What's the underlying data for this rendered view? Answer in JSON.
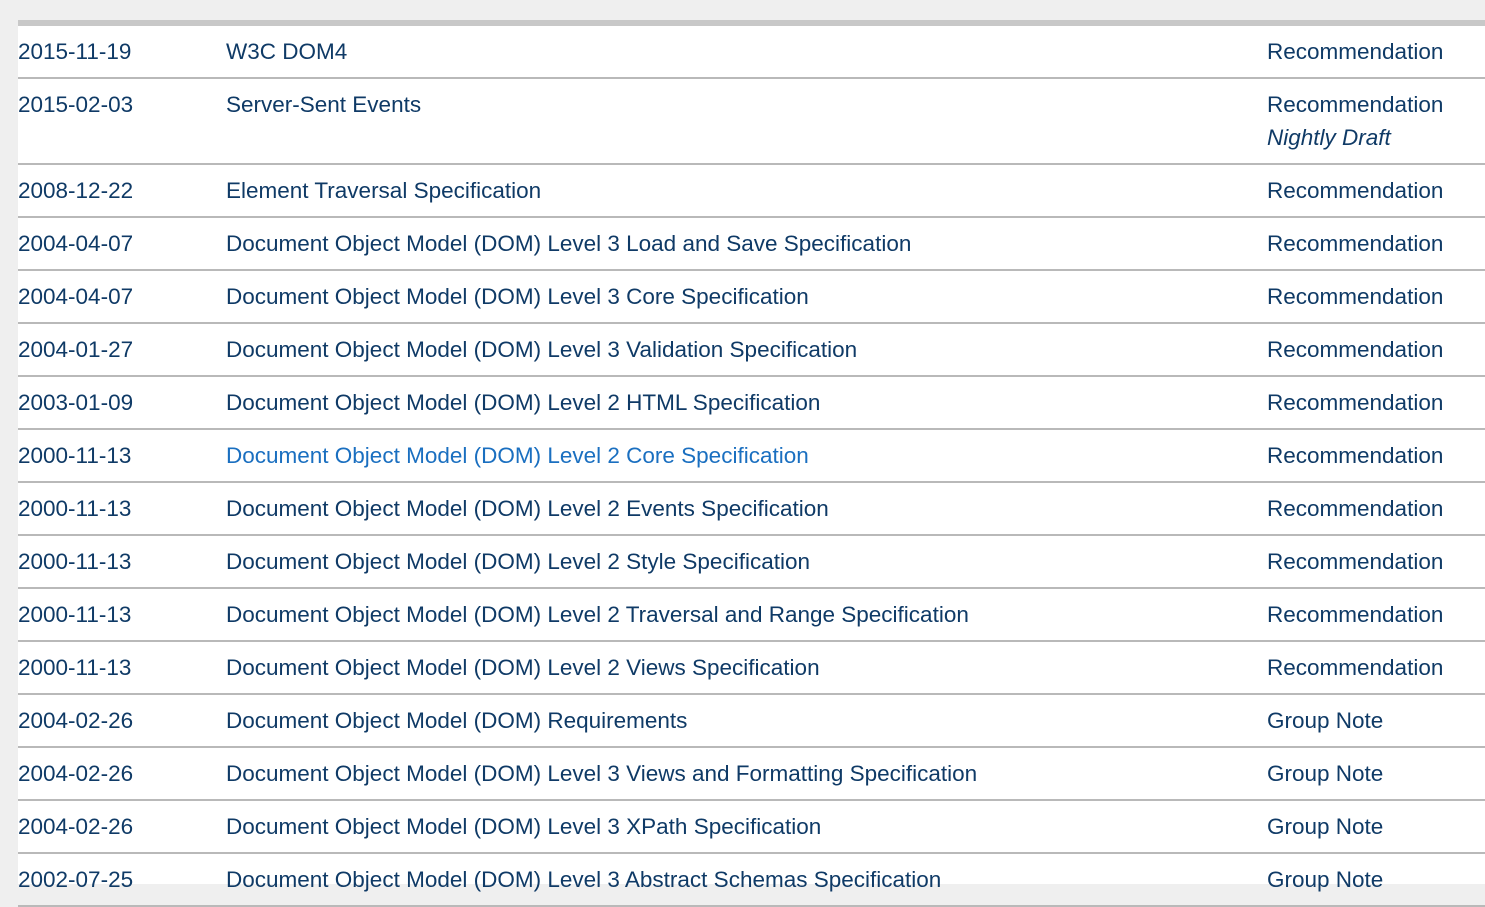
{
  "colors": {
    "text": "#0f3a66",
    "link_hover": "#1a6fc0",
    "row_border": "#b9b9b9",
    "page_bg": "#efefef"
  },
  "rows": [
    {
      "date": "2015-11-19",
      "title": "W3C DOM4",
      "status": "Recommendation",
      "note": ""
    },
    {
      "date": "2015-02-03",
      "title": "Server-Sent Events",
      "status": "Recommendation",
      "note": "Nightly Draft"
    },
    {
      "date": "2008-12-22",
      "title": "Element Traversal Specification",
      "status": "Recommendation",
      "note": ""
    },
    {
      "date": "2004-04-07",
      "title": "Document Object Model (DOM) Level 3 Load and Save Specification",
      "status": "Recommendation",
      "note": ""
    },
    {
      "date": "2004-04-07",
      "title": "Document Object Model (DOM) Level 3 Core Specification",
      "status": "Recommendation",
      "note": ""
    },
    {
      "date": "2004-01-27",
      "title": "Document Object Model (DOM) Level 3 Validation Specification",
      "status": "Recommendation",
      "note": ""
    },
    {
      "date": "2003-01-09",
      "title": "Document Object Model (DOM) Level 2 HTML Specification",
      "status": "Recommendation",
      "note": ""
    },
    {
      "date": "2000-11-13",
      "title": "Document Object Model (DOM) Level 2 Core Specification",
      "status": "Recommendation",
      "note": ""
    },
    {
      "date": "2000-11-13",
      "title": "Document Object Model (DOM) Level 2 Events Specification",
      "status": "Recommendation",
      "note": ""
    },
    {
      "date": "2000-11-13",
      "title": "Document Object Model (DOM) Level 2 Style Specification",
      "status": "Recommendation",
      "note": ""
    },
    {
      "date": "2000-11-13",
      "title": "Document Object Model (DOM) Level 2 Traversal and Range Specification",
      "status": "Recommendation",
      "note": ""
    },
    {
      "date": "2000-11-13",
      "title": "Document Object Model (DOM) Level 2 Views Specification",
      "status": "Recommendation",
      "note": ""
    },
    {
      "date": "2004-02-26",
      "title": "Document Object Model (DOM) Requirements",
      "status": "Group Note",
      "note": ""
    },
    {
      "date": "2004-02-26",
      "title": "Document Object Model (DOM) Level 3 Views and Formatting Specification",
      "status": "Group Note",
      "note": ""
    },
    {
      "date": "2004-02-26",
      "title": "Document Object Model (DOM) Level 3 XPath Specification",
      "status": "Group Note",
      "note": ""
    },
    {
      "date": "2002-07-25",
      "title": "Document Object Model (DOM) Level 3 Abstract Schemas Specification",
      "status": "Group Note",
      "note": ""
    }
  ]
}
